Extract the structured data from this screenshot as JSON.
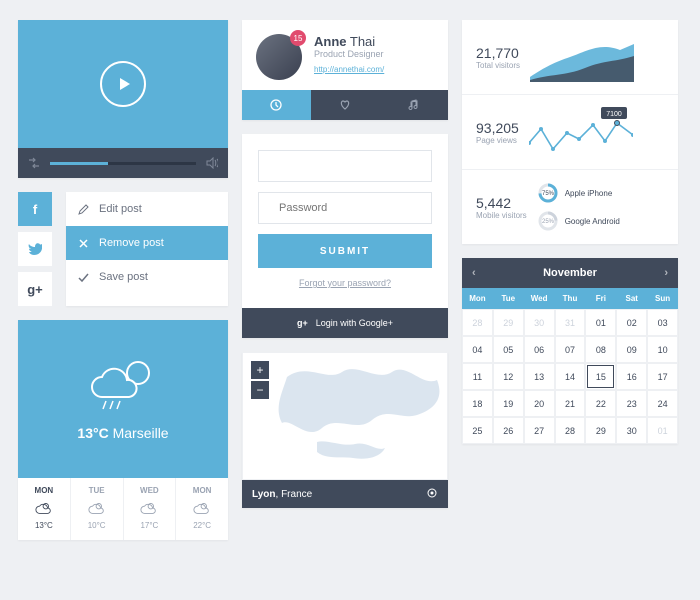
{
  "video": {
    "progress": 40
  },
  "social": {
    "fb": "f",
    "tw": "t",
    "gp": "g+"
  },
  "menu": {
    "items": [
      {
        "label": "Edit post",
        "icon": "pencil"
      },
      {
        "label": "Remove post",
        "icon": "x",
        "active": true
      },
      {
        "label": "Save post",
        "icon": "check"
      }
    ]
  },
  "weather": {
    "temp": "13°C",
    "city": "Marseille",
    "days": [
      {
        "d": "MON",
        "t": "13°C",
        "active": true
      },
      {
        "d": "TUE",
        "t": "10°C"
      },
      {
        "d": "WED",
        "t": "17°C"
      },
      {
        "d": "MON",
        "t": "22°C"
      }
    ]
  },
  "profile": {
    "name_first": "Anne",
    "name_last": "Thai",
    "title": "Product Designer",
    "url": "http://annethai.com/",
    "badge": "15"
  },
  "login": {
    "user_ph": "",
    "pass_ph": "Password",
    "submit": "SUBMIT",
    "forgot": "Forgot your password?",
    "google": "Login with Google+"
  },
  "map": {
    "city": "Lyon",
    "country": "France"
  },
  "stats": {
    "visitors": {
      "n": "21,770",
      "l": "Total visitors"
    },
    "views": {
      "n": "93,205",
      "l": "Page views",
      "tip": "7100"
    },
    "mobile": {
      "n": "5,442",
      "l": "Mobile visitors"
    },
    "devices": [
      {
        "p": "75%",
        "name": "Apple iPhone"
      },
      {
        "p": "25%",
        "name": "Google Android"
      }
    ]
  },
  "calendar": {
    "month": "November",
    "dow": [
      "Mon",
      "Tue",
      "Wed",
      "Thu",
      "Fri",
      "Sat",
      "Sun"
    ],
    "cells": [
      {
        "n": "28",
        "dim": 1
      },
      {
        "n": "29",
        "dim": 1
      },
      {
        "n": "30",
        "dim": 1
      },
      {
        "n": "31",
        "dim": 1
      },
      {
        "n": "01"
      },
      {
        "n": "02"
      },
      {
        "n": "03"
      },
      {
        "n": "04"
      },
      {
        "n": "05"
      },
      {
        "n": "06"
      },
      {
        "n": "07"
      },
      {
        "n": "08"
      },
      {
        "n": "09"
      },
      {
        "n": "10"
      },
      {
        "n": "11"
      },
      {
        "n": "12"
      },
      {
        "n": "13"
      },
      {
        "n": "14"
      },
      {
        "n": "15",
        "today": 1
      },
      {
        "n": "16"
      },
      {
        "n": "17"
      },
      {
        "n": "18"
      },
      {
        "n": "19"
      },
      {
        "n": "20"
      },
      {
        "n": "21"
      },
      {
        "n": "22"
      },
      {
        "n": "23"
      },
      {
        "n": "24"
      },
      {
        "n": "25"
      },
      {
        "n": "26"
      },
      {
        "n": "27"
      },
      {
        "n": "28"
      },
      {
        "n": "29"
      },
      {
        "n": "30"
      },
      {
        "n": "01",
        "dim": 1
      }
    ]
  },
  "chart_data": [
    {
      "type": "area",
      "title": "Total visitors",
      "values": [
        20,
        28,
        35,
        44,
        50,
        46,
        60
      ]
    },
    {
      "type": "line",
      "title": "Page views",
      "values": [
        30,
        62,
        20,
        55,
        42,
        70,
        36,
        71,
        48
      ],
      "annotation": {
        "index": 7,
        "value": 7100
      }
    },
    {
      "type": "pie",
      "title": "Mobile visitors",
      "series": [
        {
          "name": "Apple iPhone",
          "value": 75
        },
        {
          "name": "Google Android",
          "value": 25
        }
      ]
    }
  ]
}
